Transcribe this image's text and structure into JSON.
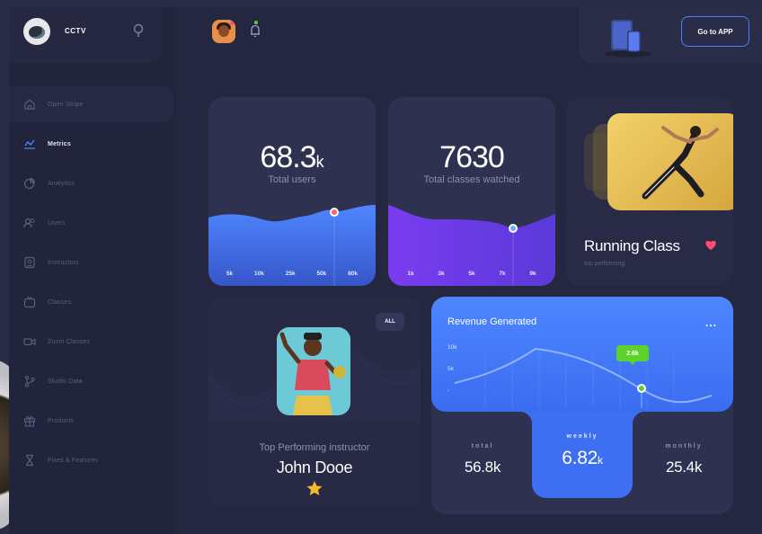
{
  "brand": {
    "name": "CCTV"
  },
  "sidebar": {
    "items": [
      {
        "label": "Open Stripe",
        "icon": "home-icon"
      },
      {
        "label": "Metrics",
        "icon": "trend-chart-icon"
      },
      {
        "label": "Analytics",
        "icon": "pie-chart-icon"
      },
      {
        "label": "Users",
        "icon": "users-icon"
      },
      {
        "label": "Instructors",
        "icon": "id-badge-icon"
      },
      {
        "label": "Classes",
        "icon": "tv-icon"
      },
      {
        "label": "Zoom Classes",
        "icon": "video-camera-icon"
      },
      {
        "label": "Studio Data",
        "icon": "branch-icon"
      },
      {
        "label": "Products",
        "icon": "gift-icon"
      },
      {
        "label": "Fixes & Features",
        "icon": "hourglass-icon"
      }
    ],
    "active_index": 1
  },
  "topbar": {
    "goto_label": "Go to APP"
  },
  "stats": [
    {
      "value": "68.3",
      "unit": "k",
      "label": "Total users",
      "ticks": [
        "5k",
        "10k",
        "25k",
        "50k",
        "80k"
      ]
    },
    {
      "value": "7630",
      "unit": "",
      "label": "Total classes watched",
      "ticks": [
        "1k",
        "3k",
        "5k",
        "7k",
        "9k"
      ]
    }
  ],
  "running": {
    "title": "Running Class",
    "subtitle": "top performing"
  },
  "instructor": {
    "badge": "ALL",
    "caption": "Top Performing instructor",
    "name": "John Dooe"
  },
  "revenue": {
    "title": "Revenue Generated",
    "more": "...",
    "y_labels": [
      "10k",
      "5k",
      "-"
    ],
    "tooltip": "2.6k",
    "periods": [
      {
        "label": "total",
        "value": "56.8k",
        "unit": ""
      },
      {
        "label": "weekly",
        "value": "6.82",
        "unit": "k"
      },
      {
        "label": "monthly",
        "value": "25.4k",
        "unit": ""
      }
    ]
  },
  "colors": {
    "accent": "#4e86ff",
    "purple": "#7a3cf0",
    "green": "#5dd22b",
    "heart": "#ff4d6d"
  }
}
